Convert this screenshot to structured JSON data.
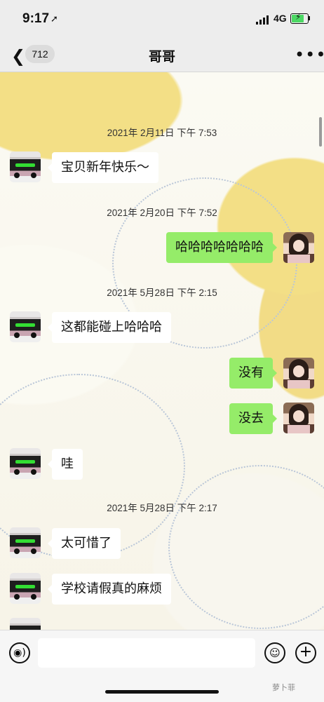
{
  "status": {
    "time": "9:17",
    "network": "4G"
  },
  "nav": {
    "unread": "712",
    "title": "哥哥"
  },
  "messages": [
    {
      "timestamp": "2021年 2月11日 下午 7:53"
    },
    {
      "left": "宝贝新年快乐～"
    },
    {
      "timestamp": "2021年 2月20日 下午 7:52"
    },
    {
      "right": "哈哈哈哈哈哈哈"
    },
    {
      "timestamp": "2021年 5月28日 下午 2:15"
    },
    {
      "left": "这都能碰上哈哈哈"
    },
    {
      "right": "没有"
    },
    {
      "right": "没去"
    },
    {
      "left": "哇"
    },
    {
      "timestamp": "2021年 5月28日 下午 2:17"
    },
    {
      "left": "太可惜了"
    },
    {
      "left": "学校请假真的麻烦"
    }
  ],
  "input": {
    "placeholder": ""
  },
  "watermark": "萝卜菲"
}
